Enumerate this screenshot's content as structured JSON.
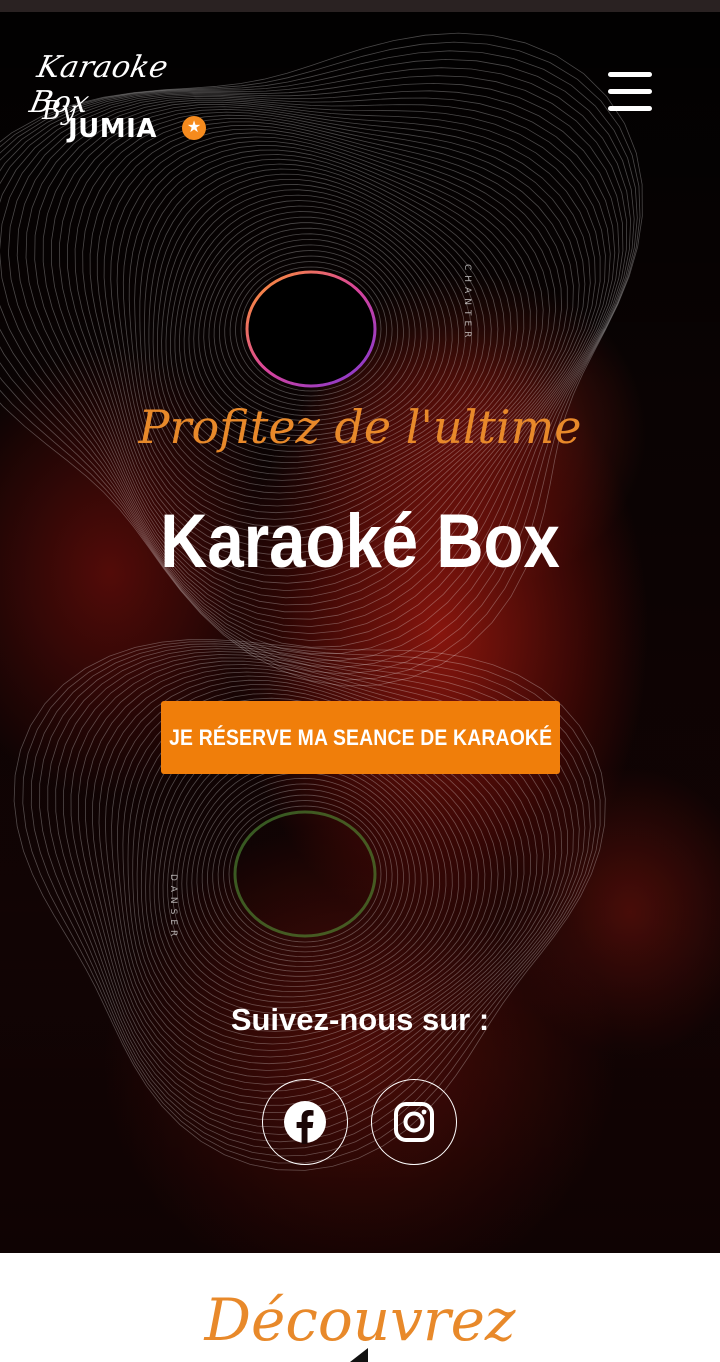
{
  "header": {
    "logo": {
      "script": "Karaoke Box",
      "by": "By",
      "brand": "JUMIA",
      "star": "★"
    }
  },
  "hero": {
    "side_word_top": "CHANTER",
    "side_word_bottom": "DANSER",
    "tagline": "Profitez de l'ultime",
    "title": "Karaoké Box",
    "cta_label": "JE RÉSERVE MA SEANCE DE KARAOKÉ",
    "follow_label": "Suivez-nous sur :"
  },
  "next_section": {
    "heading": "Découvrez"
  },
  "colors": {
    "accent": "#f07e0a",
    "tagline": "#e8892a",
    "hero_background": "#050202"
  }
}
